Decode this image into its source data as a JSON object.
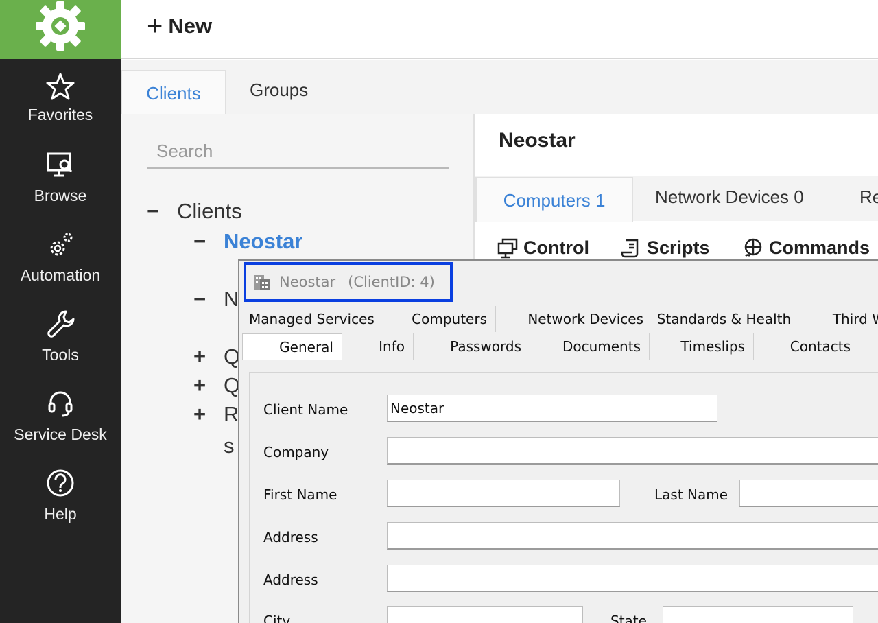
{
  "sidebar": {
    "items": [
      {
        "label": "Favorites",
        "icon": "star-icon"
      },
      {
        "label": "Browse",
        "icon": "monitor-search-icon"
      },
      {
        "label": "Automation",
        "icon": "gears-icon"
      },
      {
        "label": "Tools",
        "icon": "wrench-icon"
      },
      {
        "label": "Service Desk",
        "icon": "headset-icon"
      },
      {
        "label": "Help",
        "icon": "question-icon"
      }
    ],
    "accent": "#6ab04c"
  },
  "header": {
    "new_label": "New"
  },
  "tabs": {
    "clients": "Clients",
    "groups": "Groups"
  },
  "search": {
    "placeholder": "Search",
    "value": ""
  },
  "tree": {
    "root": "Clients",
    "selected": "Neostar",
    "rows": [
      "N",
      "Q",
      "Q",
      "R",
      "s"
    ]
  },
  "detail": {
    "title": "Neostar",
    "tabs": [
      "Computers 1",
      "Network Devices 0",
      "Re"
    ],
    "toolbar": [
      "Control",
      "Scripts",
      "Commands"
    ]
  },
  "window": {
    "title": "Neostar",
    "client_id": "(ClientID: 4)",
    "tabs_row1": [
      "Managed Services",
      "Computers",
      "Network Devices",
      "Standards & Health",
      "Third W"
    ],
    "tabs_row2": [
      "General",
      "Info",
      "Passwords",
      "Documents",
      "Timeslips",
      "Contacts"
    ],
    "fields": {
      "client_name_label": "Client Name",
      "client_name_value": "Neostar",
      "company_label": "Company",
      "first_name_label": "First Name",
      "last_name_label": "Last Name",
      "address1_label": "Address",
      "address2_label": "Address",
      "city_label": "City",
      "state_label": "State"
    }
  }
}
